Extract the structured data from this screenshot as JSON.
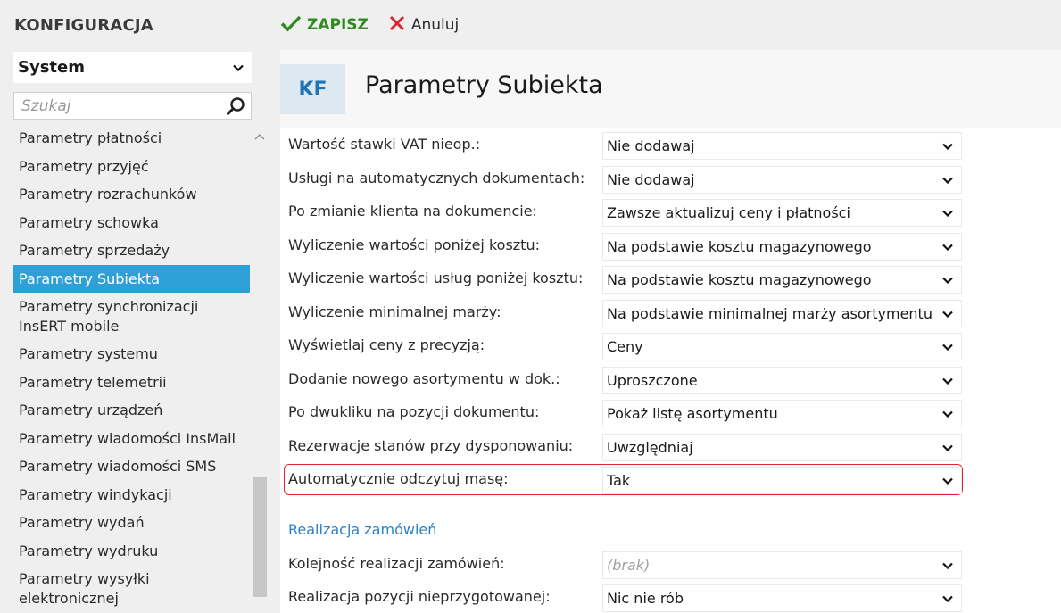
{
  "sidebar": {
    "title": "KONFIGURACJA",
    "module_value": "System",
    "search_placeholder": "Szukaj",
    "items": [
      "Parametry płatności",
      "Parametry przyjęć",
      "Parametry rozrachunków",
      "Parametry schowka",
      "Parametry sprzedaży",
      "Parametry Subiekta",
      "Parametry synchronizacji InsERT mobile",
      "Parametry systemu",
      "Parametry telemetrii",
      "Parametry urządzeń",
      "Parametry wiadomości InsMail",
      "Parametry wiadomości SMS",
      "Parametry windykacji",
      "Parametry wydań",
      "Parametry wydruku",
      "Parametry wysyłki elektronicznej"
    ],
    "active_item": "Parametry Subiekta"
  },
  "toolbar": {
    "save_label": "ZAPISZ",
    "cancel_label": "Anuluj"
  },
  "header": {
    "badge": "KF",
    "title": "Parametry Subiekta"
  },
  "settings": [
    {
      "label": "Wartość stawki VAT nieop.:",
      "value": "Nie dodawaj"
    },
    {
      "label": "Usługi na automatycznych dokumentach:",
      "value": "Nie dodawaj"
    },
    {
      "label": "Po zmianie klienta na dokumencie:",
      "value": "Zawsze aktualizuj ceny i płatności"
    },
    {
      "label": "Wyliczenie wartości poniżej kosztu:",
      "value": "Na podstawie kosztu magazynowego"
    },
    {
      "label": "Wyliczenie wartości usług poniżej kosztu:",
      "value": "Na podstawie kosztu magazynowego"
    },
    {
      "label": "Wyliczenie minimalnej marży:",
      "value": "Na podstawie minimalnej marży asortymentu"
    },
    {
      "label": "Wyświetlaj ceny z precyzją:",
      "value": "Ceny"
    },
    {
      "label": "Dodanie nowego asortymentu w dok.:",
      "value": "Uproszczone"
    },
    {
      "label": "Po dwukliku na pozycji dokumentu:",
      "value": "Pokaż listę asortymentu"
    },
    {
      "label": "Rezerwacje stanów przy dysponowaniu:",
      "value": "Uwzględniaj"
    },
    {
      "label": "Automatycznie odczytuj masę:",
      "value": "Tak"
    }
  ],
  "section": {
    "title": "Realizacja zamówień",
    "settings": [
      {
        "label": "Kolejność realizacji zamówień:",
        "value": "",
        "placeholder": "(brak)"
      },
      {
        "label": "Realizacja pozycji nieprzygotowanej:",
        "value": "Nic nie rób"
      }
    ]
  },
  "colors": {
    "accent": "#2f9fd8",
    "save_green": "#2e8b1e",
    "cancel_red": "#d9262f",
    "highlight_red": "#e0262e",
    "section_blue": "#2b82c6",
    "badge_bg": "#dde8f1",
    "badge_text": "#1f73b7"
  },
  "icons": {
    "save": "checkmark-icon",
    "cancel": "x-icon",
    "search": "search-icon",
    "dropdown": "chevron-down-icon",
    "scroll_up": "chevron-up-icon"
  }
}
